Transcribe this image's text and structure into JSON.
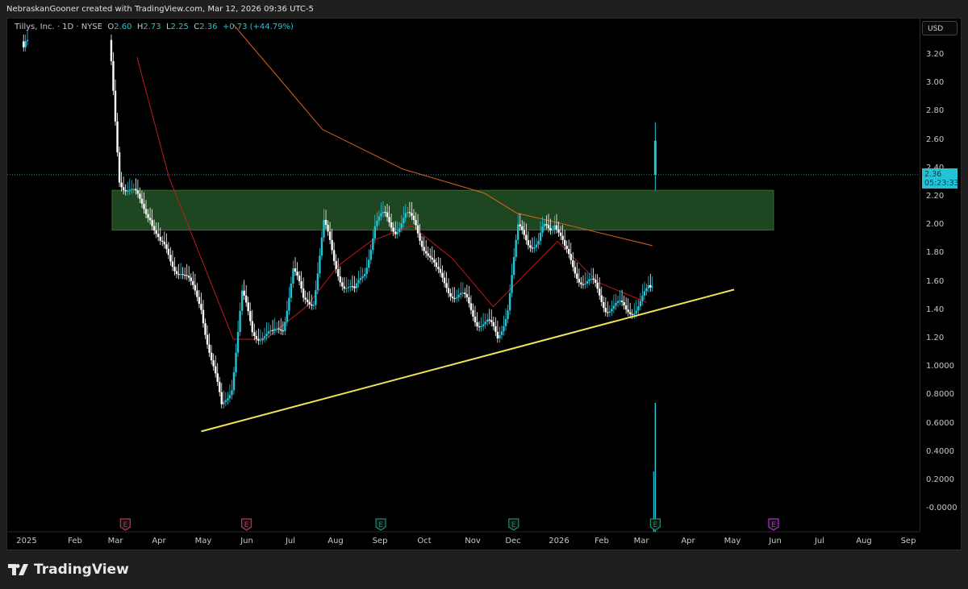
{
  "credit": "NebraskanGooner created with TradingView.com, Mar 12, 2026 09:36 UTC-5",
  "legend": {
    "symbol": "Tillys, Inc. · 1D · NYSE",
    "o_label": "O",
    "o": "2.60",
    "h_label": "H",
    "h": "2.73",
    "l_label": "L",
    "l": "2.25",
    "c_label": "C",
    "c": "2.36",
    "change": "+0.73 (+44.79%)"
  },
  "currency": "USD",
  "last_price": {
    "price": "2.36",
    "countdown": "05:23:33"
  },
  "brand": "TradingView",
  "colors": {
    "up": "#22c3d6",
    "down": "#ffffff",
    "ma_fast": "#c21a1a",
    "ma_slow": "#e0641e",
    "zone": "#1e4620",
    "trendline": "#f2e35a",
    "earn_past_red": "#c2334a",
    "earn_past_green": "#1f8a70",
    "earn_future": "#b12ec8"
  },
  "chart_data": {
    "type": "candlestick",
    "y_ticks": [
      "3.20",
      "3.00",
      "2.80",
      "2.60",
      "2.40",
      "2.20",
      "2.00",
      "1.80",
      "1.60",
      "1.40",
      "1.20",
      "1.0000",
      "0.8000",
      "0.6000",
      "0.4000",
      "0.2000",
      "-0.0000"
    ],
    "ylim": [
      -0.05,
      3.4
    ],
    "x_ticks": [
      "2025",
      "Feb",
      "Mar",
      "Apr",
      "May",
      "Jun",
      "Jul",
      "Aug",
      "Sep",
      "Oct",
      "Nov",
      "Dec",
      "2026",
      "Feb",
      "Mar",
      "Apr",
      "May",
      "Jun",
      "Jul",
      "Aug",
      "Sep"
    ],
    "closes": [
      [
        "2025-01-02",
        3.3
      ],
      [
        "2025-01-06",
        3.25
      ],
      [
        "2025-03-03",
        3.3
      ],
      [
        "2025-03-10",
        2.35
      ],
      [
        "2025-03-17",
        2.25
      ],
      [
        "2025-03-24",
        2.15
      ],
      [
        "2025-03-31",
        2.1
      ],
      [
        "2025-04-07",
        1.85
      ],
      [
        "2025-04-14",
        1.75
      ],
      [
        "2025-04-21",
        1.7
      ],
      [
        "2025-04-28",
        1.55
      ],
      [
        "2025-05-05",
        1.45
      ],
      [
        "2025-05-12",
        1.05
      ],
      [
        "2025-05-19",
        0.7
      ],
      [
        "2025-05-26",
        0.9
      ],
      [
        "2025-06-02",
        1.5
      ],
      [
        "2025-06-09",
        1.25
      ],
      [
        "2025-06-16",
        1.25
      ],
      [
        "2025-06-23",
        1.2
      ],
      [
        "2025-06-30",
        1.3
      ],
      [
        "2025-07-07",
        1.7
      ],
      [
        "2025-07-14",
        1.45
      ],
      [
        "2025-07-21",
        1.5
      ],
      [
        "2025-07-28",
        2.0
      ],
      [
        "2025-08-04",
        1.75
      ],
      [
        "2025-08-11",
        1.6
      ],
      [
        "2025-08-18",
        1.5
      ],
      [
        "2025-08-25",
        1.7
      ],
      [
        "2025-09-01",
        2.0
      ],
      [
        "2025-09-08",
        2.05
      ],
      [
        "2025-09-15",
        2.0
      ],
      [
        "2025-09-22",
        2.05
      ],
      [
        "2025-09-29",
        2.0
      ],
      [
        "2025-10-06",
        1.85
      ],
      [
        "2025-10-13",
        1.65
      ],
      [
        "2025-10-20",
        1.6
      ],
      [
        "2025-10-27",
        1.5
      ],
      [
        "2025-11-03",
        1.45
      ],
      [
        "2025-11-10",
        1.35
      ],
      [
        "2025-11-17",
        1.3
      ],
      [
        "2025-11-24",
        1.2
      ],
      [
        "2025-12-01",
        1.45
      ],
      [
        "2025-12-08",
        1.95
      ],
      [
        "2025-12-15",
        1.9
      ],
      [
        "2025-12-22",
        1.9
      ],
      [
        "2026-01-02",
        2.05
      ],
      [
        "2026-01-09",
        1.8
      ],
      [
        "2026-01-16",
        1.7
      ],
      [
        "2026-01-23",
        1.6
      ],
      [
        "2026-01-30",
        1.55
      ],
      [
        "2026-02-06",
        1.45
      ],
      [
        "2026-02-13",
        1.42
      ],
      [
        "2026-02-20",
        1.4
      ],
      [
        "2026-02-27",
        1.45
      ],
      [
        "2026-03-06",
        1.5
      ],
      [
        "2026-03-10",
        1.63
      ],
      [
        "2026-03-12",
        2.36
      ]
    ],
    "last_candle": {
      "date": "2026-03-12",
      "open": 2.6,
      "high": 2.73,
      "low": 2.25,
      "close": 2.36
    },
    "ma_fast": [
      [
        "2025-03-22",
        3.19
      ],
      [
        "2025-04-13",
        2.34
      ],
      [
        "2025-05-05",
        1.77
      ],
      [
        "2025-05-27",
        1.2
      ],
      [
        "2025-06-18",
        1.2
      ],
      [
        "2025-07-16",
        1.43
      ],
      [
        "2025-08-07",
        1.72
      ],
      [
        "2025-08-29",
        1.89
      ],
      [
        "2025-09-26",
        2.0
      ],
      [
        "2025-10-24",
        1.77
      ],
      [
        "2025-11-21",
        1.43
      ],
      [
        "2025-12-13",
        1.66
      ],
      [
        "2026-01-04",
        1.89
      ],
      [
        "2026-02-01",
        1.6
      ],
      [
        "2026-03-06",
        1.46
      ]
    ],
    "ma_slow": [
      [
        "2025-05-27",
        3.42
      ],
      [
        "2025-07-27",
        2.68
      ],
      [
        "2025-09-20",
        2.4
      ],
      [
        "2025-11-15",
        2.23
      ],
      [
        "2025-12-07",
        2.09
      ],
      [
        "2026-01-09",
        2.01
      ],
      [
        "2026-03-10",
        1.86
      ]
    ],
    "zone": {
      "from": "2025-03-05",
      "to": "2026-06-01",
      "low": 1.97,
      "high": 2.25
    },
    "trendline": {
      "from": [
        "2025-05-05",
        0.55
      ],
      "to": [
        "2026-05-05",
        1.55
      ]
    },
    "earnings": [
      [
        "2025-03-14",
        "past-red"
      ],
      [
        "2025-06-05",
        "past-red"
      ],
      [
        "2025-09-05",
        "past-green"
      ],
      [
        "2025-12-05",
        "past-green"
      ],
      [
        "2026-03-12",
        "past-green"
      ],
      [
        "2026-06-01",
        "future"
      ]
    ],
    "earnings_label": "E"
  }
}
